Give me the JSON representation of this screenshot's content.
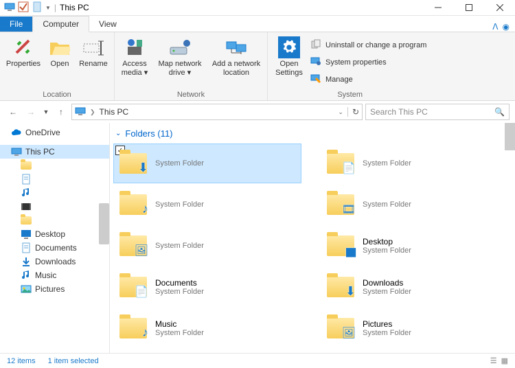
{
  "window": {
    "title": "This PC"
  },
  "tabs": {
    "file": "File",
    "computer": "Computer",
    "view": "View"
  },
  "ribbon": {
    "location": {
      "label": "Location",
      "properties": "Properties",
      "open": "Open",
      "rename": "Rename"
    },
    "network": {
      "label": "Network",
      "access_media": "Access media",
      "map_drive": "Map network drive",
      "add_location": "Add a network location"
    },
    "system": {
      "label": "System",
      "open_settings": "Open Settings",
      "uninstall": "Uninstall or change a program",
      "properties": "System properties",
      "manage": "Manage"
    }
  },
  "address": {
    "path": "This PC"
  },
  "search": {
    "placeholder": "Search This PC"
  },
  "sidebar": {
    "items": [
      {
        "label": "OneDrive",
        "icon": "cloud",
        "indent": 0
      },
      {
        "label": "This PC",
        "icon": "pc",
        "indent": 0,
        "selected": true
      },
      {
        "label": "",
        "icon": "folder",
        "indent": 1
      },
      {
        "label": "",
        "icon": "doc",
        "indent": 1
      },
      {
        "label": "",
        "icon": "music",
        "indent": 1
      },
      {
        "label": "",
        "icon": "video",
        "indent": 1
      },
      {
        "label": "",
        "icon": "folder",
        "indent": 1
      },
      {
        "label": "Desktop",
        "icon": "desktop",
        "indent": 1
      },
      {
        "label": "Documents",
        "icon": "doc",
        "indent": 1
      },
      {
        "label": "Downloads",
        "icon": "download",
        "indent": 1
      },
      {
        "label": "Music",
        "icon": "music",
        "indent": 1
      },
      {
        "label": "Pictures",
        "icon": "picture",
        "indent": 1
      }
    ]
  },
  "section": {
    "header": "Folders (11)"
  },
  "folders": [
    {
      "name": "",
      "sublabel": "System Folder",
      "icon": "download",
      "selected": true
    },
    {
      "name": "",
      "sublabel": "System Folder",
      "icon": "doc"
    },
    {
      "name": "",
      "sublabel": "System Folder",
      "icon": "music"
    },
    {
      "name": "",
      "sublabel": "System Folder",
      "icon": "video"
    },
    {
      "name": "",
      "sublabel": "System Folder",
      "icon": "picture"
    },
    {
      "name": "Desktop",
      "sublabel": "System Folder",
      "icon": "desktop"
    },
    {
      "name": "Documents",
      "sublabel": "System Folder",
      "icon": "doc"
    },
    {
      "name": "Downloads",
      "sublabel": "System Folder",
      "icon": "download"
    },
    {
      "name": "Music",
      "sublabel": "System Folder",
      "icon": "music"
    },
    {
      "name": "Pictures",
      "sublabel": "System Folder",
      "icon": "picture"
    }
  ],
  "status": {
    "items": "12 items",
    "selected": "1 item selected"
  }
}
